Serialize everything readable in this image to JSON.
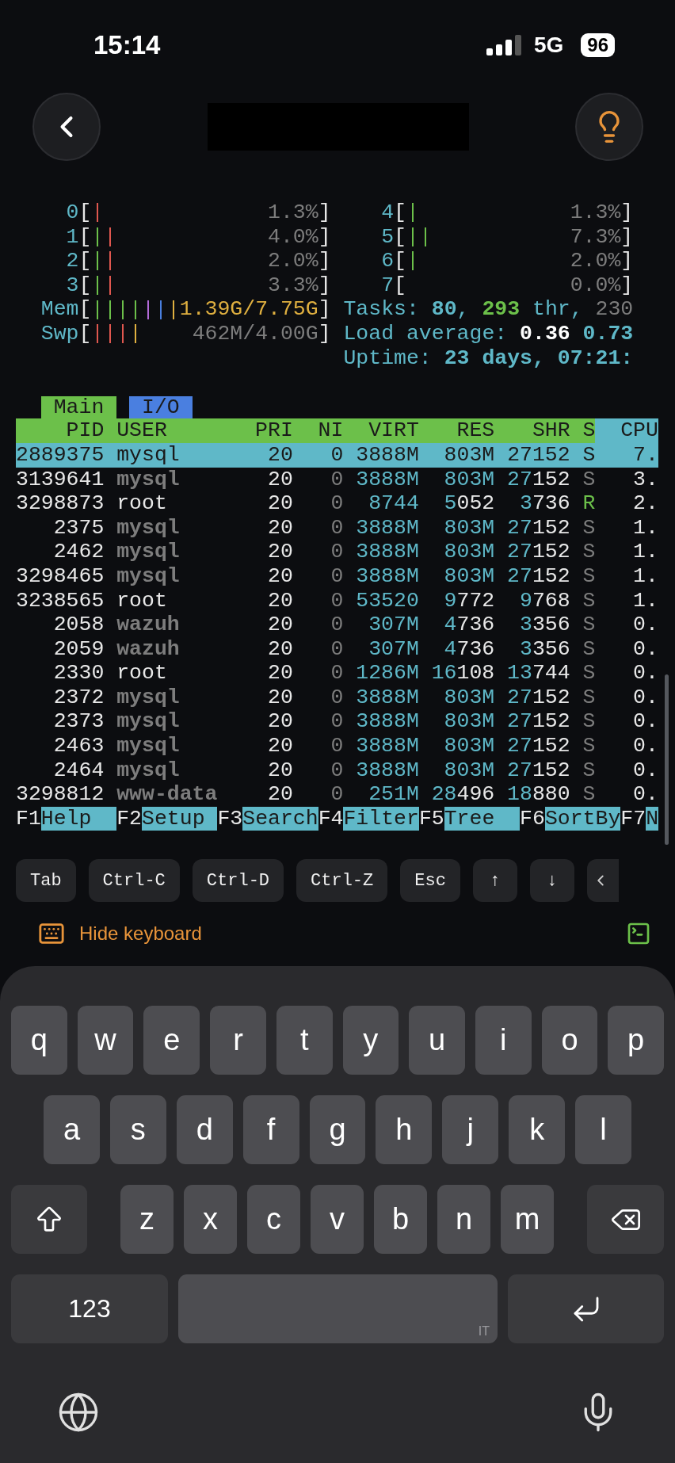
{
  "status_bar": {
    "time": "15:14",
    "network": "5G",
    "battery": "96"
  },
  "terminal": {
    "cpu_meters": [
      {
        "label": "0",
        "open": "[",
        "close": "]",
        "reading": "1.3%",
        "bars": [
          {
            "color": "#e0574f"
          }
        ]
      },
      {
        "label": "1",
        "open": "[",
        "close": "]",
        "reading": "4.0%",
        "bars": [
          {
            "color": "#6cc04a"
          },
          {
            "color": "#e0574f"
          }
        ]
      },
      {
        "label": "2",
        "open": "[",
        "close": "]",
        "reading": "2.0%",
        "bars": [
          {
            "color": "#6cc04a"
          },
          {
            "color": "#e0574f"
          }
        ]
      },
      {
        "label": "3",
        "open": "[",
        "close": "]",
        "reading": "3.3%",
        "bars": [
          {
            "color": "#6cc04a"
          },
          {
            "color": "#e0574f"
          }
        ]
      },
      {
        "label": "4",
        "open": "[",
        "close": "]",
        "reading": "1.3%",
        "bars": [
          {
            "color": "#6cc04a"
          }
        ]
      },
      {
        "label": "5",
        "open": "[",
        "close": "]",
        "reading": "7.3%",
        "bars": [
          {
            "color": "#6cc04a"
          },
          {
            "color": "#6cc04a"
          }
        ]
      },
      {
        "label": "6",
        "open": "[",
        "close": "]",
        "reading": "2.0%",
        "bars": [
          {
            "color": "#6cc04a"
          }
        ]
      },
      {
        "label": "7",
        "open": "[",
        "close": "]",
        "reading": "0.0%"
      }
    ],
    "memory_meters": [
      {
        "label": "Mem",
        "open": "[",
        "close": "]",
        "reading": "1.39G/7.75G",
        "color": "#e0b040",
        "bars": [
          {
            "color": "#6cc04a"
          },
          {
            "color": "#6cc04a"
          },
          {
            "color": "#6cc04a"
          },
          {
            "color": "#6cc04a"
          },
          {
            "color": "#b36ad8"
          },
          {
            "color": "#4a7fe0"
          },
          {
            "color": "#e0b040"
          }
        ]
      },
      {
        "label": "Swp",
        "open": "[",
        "close": "]",
        "reading": "462M/4.00G",
        "color": "#7d7d7d",
        "bars": [
          {
            "color": "#e0574f"
          },
          {
            "color": "#e0574f"
          },
          {
            "color": "#e0574f"
          },
          {
            "color": "#e0b040"
          }
        ]
      }
    ],
    "info_lines": [
      {
        "parts": [
          {
            "text": "Tasks: ",
            "kind": "label"
          },
          {
            "text": "80",
            "kind": "value"
          },
          {
            "text": ", ",
            "kind": "label"
          },
          {
            "text": "293",
            "kind": "threads"
          },
          {
            "text": " thr, ",
            "kind": "label"
          },
          {
            "text": "230",
            "kind": "muted"
          }
        ]
      },
      {
        "parts": [
          {
            "text": "Load average: ",
            "kind": "label"
          },
          {
            "text": "0.36",
            "kind": "bright"
          },
          {
            "text": " 0.73",
            "kind": "value"
          }
        ]
      },
      {
        "parts": [
          {
            "text": "Uptime: ",
            "kind": "label"
          },
          {
            "text": "23 days, 07:21:",
            "kind": "value"
          }
        ]
      }
    ],
    "tabs": [
      {
        "label": "Main",
        "selected": true
      },
      {
        "label": "I/O",
        "selected": false
      }
    ],
    "columns": [
      {
        "label": "PID",
        "sorted": false
      },
      {
        "label": "USER",
        "sorted": false
      },
      {
        "label": "PRI",
        "sorted": false
      },
      {
        "label": "NI",
        "sorted": false
      },
      {
        "label": "VIRT",
        "sorted": false
      },
      {
        "label": "RES",
        "sorted": false
      },
      {
        "label": "SHR",
        "sorted": false
      },
      {
        "label": "S",
        "sorted": false
      },
      {
        "label": "CPU",
        "sorted": true
      }
    ],
    "rows": [
      {
        "pid": "2889375",
        "user": "mysql",
        "pri": "20",
        "ni": "0",
        "virt": "3888M",
        "res": "803M",
        "shr": "27152",
        "state": "S",
        "cpu": "7.",
        "selected": true
      },
      {
        "pid": "3139641",
        "user": "mysql",
        "pri": "20",
        "ni": "0",
        "virt": "3888M",
        "res": "803M",
        "shr": "27152",
        "state": "S",
        "cpu": "3.",
        "selected": false,
        "user_dimmed": true,
        "running": false
      },
      {
        "pid": "3298873",
        "user": "root",
        "pri": "20",
        "ni": "0",
        "virt": "8744",
        "res": "5052",
        "shr": "3736",
        "state": "R",
        "cpu": "2.",
        "selected": false,
        "user_dimmed": false,
        "running": true
      },
      {
        "pid": "2375",
        "user": "mysql",
        "pri": "20",
        "ni": "0",
        "virt": "3888M",
        "res": "803M",
        "shr": "27152",
        "state": "S",
        "cpu": "1.",
        "selected": false,
        "user_dimmed": true,
        "running": false
      },
      {
        "pid": "2462",
        "user": "mysql",
        "pri": "20",
        "ni": "0",
        "virt": "3888M",
        "res": "803M",
        "shr": "27152",
        "state": "S",
        "cpu": "1.",
        "selected": false,
        "user_dimmed": true,
        "running": false
      },
      {
        "pid": "3298465",
        "user": "mysql",
        "pri": "20",
        "ni": "0",
        "virt": "3888M",
        "res": "803M",
        "shr": "27152",
        "state": "S",
        "cpu": "1.",
        "selected": false,
        "user_dimmed": true,
        "running": false
      },
      {
        "pid": "3238565",
        "user": "root",
        "pri": "20",
        "ni": "0",
        "virt": "53520",
        "res": "9772",
        "shr": "9768",
        "state": "S",
        "cpu": "1.",
        "selected": false,
        "user_dimmed": false,
        "running": false
      },
      {
        "pid": "2058",
        "user": "wazuh",
        "pri": "20",
        "ni": "0",
        "virt": "307M",
        "res": "4736",
        "shr": "3356",
        "state": "S",
        "cpu": "0.",
        "selected": false,
        "user_dimmed": true,
        "running": false
      },
      {
        "pid": "2059",
        "user": "wazuh",
        "pri": "20",
        "ni": "0",
        "virt": "307M",
        "res": "4736",
        "shr": "3356",
        "state": "S",
        "cpu": "0.",
        "selected": false,
        "user_dimmed": true,
        "running": false
      },
      {
        "pid": "2330",
        "user": "root",
        "pri": "20",
        "ni": "0",
        "virt": "1286M",
        "res": "16108",
        "shr": "13744",
        "state": "S",
        "cpu": "0.",
        "selected": false,
        "user_dimmed": false,
        "running": false
      },
      {
        "pid": "2372",
        "user": "mysql",
        "pri": "20",
        "ni": "0",
        "virt": "3888M",
        "res": "803M",
        "shr": "27152",
        "state": "S",
        "cpu": "0.",
        "selected": false,
        "user_dimmed": true,
        "running": false
      },
      {
        "pid": "2373",
        "user": "mysql",
        "pri": "20",
        "ni": "0",
        "virt": "3888M",
        "res": "803M",
        "shr": "27152",
        "state": "S",
        "cpu": "0.",
        "selected": false,
        "user_dimmed": true,
        "running": false
      },
      {
        "pid": "2463",
        "user": "mysql",
        "pri": "20",
        "ni": "0",
        "virt": "3888M",
        "res": "803M",
        "shr": "27152",
        "state": "S",
        "cpu": "0.",
        "selected": false,
        "user_dimmed": true,
        "running": false
      },
      {
        "pid": "2464",
        "user": "mysql",
        "pri": "20",
        "ni": "0",
        "virt": "3888M",
        "res": "803M",
        "shr": "27152",
        "state": "S",
        "cpu": "0.",
        "selected": false,
        "user_dimmed": true,
        "running": false
      },
      {
        "pid": "3298812",
        "user": "www-data",
        "pri": "20",
        "ni": "0",
        "virt": "251M",
        "res": "28496",
        "shr": "18880",
        "state": "S",
        "cpu": "0.",
        "selected": false,
        "user_dimmed": true,
        "running": false
      }
    ],
    "function_keys": [
      {
        "key": "F1",
        "label": "Help"
      },
      {
        "key": "F2",
        "label": "Setup"
      },
      {
        "key": "F3",
        "label": "Search"
      },
      {
        "key": "F4",
        "label": "Filter"
      },
      {
        "key": "F5",
        "label": "Tree"
      },
      {
        "key": "F6",
        "label": "SortBy"
      },
      {
        "key": "F7",
        "label": "N"
      }
    ]
  },
  "toolbar": {
    "keys": [
      "Tab",
      "Ctrl-C",
      "Ctrl-D",
      "Ctrl-Z",
      "Esc",
      "↑",
      "↓"
    ],
    "hide_keyboard": "Hide keyboard"
  },
  "keyboard": {
    "rows": [
      [
        "q",
        "w",
        "e",
        "r",
        "t",
        "y",
        "u",
        "i",
        "o",
        "p"
      ],
      [
        "a",
        "s",
        "d",
        "f",
        "g",
        "h",
        "j",
        "k",
        "l"
      ],
      [
        "z",
        "x",
        "c",
        "v",
        "b",
        "n",
        "m"
      ]
    ],
    "numbers_key": "123",
    "space_hint": "IT"
  }
}
